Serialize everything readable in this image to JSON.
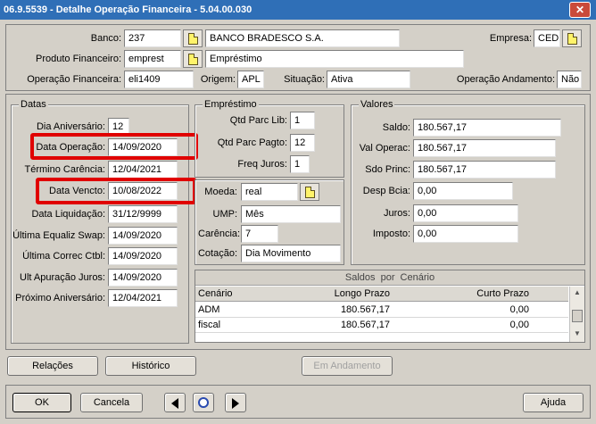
{
  "window": {
    "title": "06.9.5539 - Detalhe Operação Financeira - 5.04.00.030",
    "close": "✕"
  },
  "header": {
    "banco_label": "Banco:",
    "banco_code": "237",
    "banco_name": "BANCO BRADESCO S.A.",
    "empresa_label": "Empresa:",
    "empresa_value": "CED",
    "produto_label": "Produto Financeiro:",
    "produto_code": "emprest",
    "produto_name": "Empréstimo",
    "operacao_label": "Operação Financeira:",
    "operacao_value": "eli1409",
    "origem_label": "Origem:",
    "origem_value": "APL",
    "situacao_label": "Situação:",
    "situacao_value": "Ativa",
    "andamento_label": "Operação Andamento:",
    "andamento_value": "Não"
  },
  "datas": {
    "title": "Datas",
    "rows": [
      {
        "label": "Dia Aniversário:",
        "value": "12"
      },
      {
        "label": "Data Operação:",
        "value": "14/09/2020"
      },
      {
        "label": "Término Carência:",
        "value": "12/04/2021"
      },
      {
        "label": "Data Vencto:",
        "value": "10/08/2022"
      },
      {
        "label": "Data Liquidação:",
        "value": "31/12/9999"
      },
      {
        "label": "Última Equaliz Swap:",
        "value": "14/09/2020"
      },
      {
        "label": "Última Correc Ctbl:",
        "value": "14/09/2020"
      },
      {
        "label": "Ult Apuração Juros:",
        "value": "14/09/2020"
      },
      {
        "label": "Próximo Aniversário:",
        "value": "12/04/2021"
      }
    ]
  },
  "emprestimo": {
    "title": "Empréstimo",
    "rows": [
      {
        "label": "Qtd Parc Lib:",
        "value": "1"
      },
      {
        "label": "Qtd Parc Pagto:",
        "value": "12"
      },
      {
        "label": "Freq Juros:",
        "value": "1"
      }
    ]
  },
  "moeda": {
    "moeda_label": "Moeda:",
    "moeda_value": "real",
    "ump_label": "UMP:",
    "ump_value": "Mês",
    "carencia_label": "Carência:",
    "carencia_value": "7",
    "cotacao_label": "Cotação:",
    "cotacao_value": "Dia Movimento"
  },
  "valores": {
    "title": "Valores",
    "rows": [
      {
        "label": "Saldo:",
        "value": "180.567,17"
      },
      {
        "label": "Val Operac:",
        "value": "180.567,17"
      },
      {
        "label": "Sdo Princ:",
        "value": "180.567,17"
      },
      {
        "label": "Desp Bcia:",
        "value": "0,00"
      },
      {
        "label": "Juros:",
        "value": "0,00"
      },
      {
        "label": "Imposto:",
        "value": "0,00"
      }
    ]
  },
  "saldos": {
    "title": "Saldos por Cenário",
    "columns": [
      "Cenário",
      "Longo Prazo",
      "Curto Prazo"
    ],
    "rows": [
      [
        "ADM",
        "180.567,17",
        "0,00"
      ],
      [
        "fiscal",
        "180.567,17",
        "0,00"
      ]
    ]
  },
  "buttons": {
    "relacoes": "Relações",
    "historico": "Histórico",
    "em_andamento": "Em Andamento",
    "ok": "OK",
    "cancela": "Cancela",
    "ajuda": "Ajuda"
  }
}
